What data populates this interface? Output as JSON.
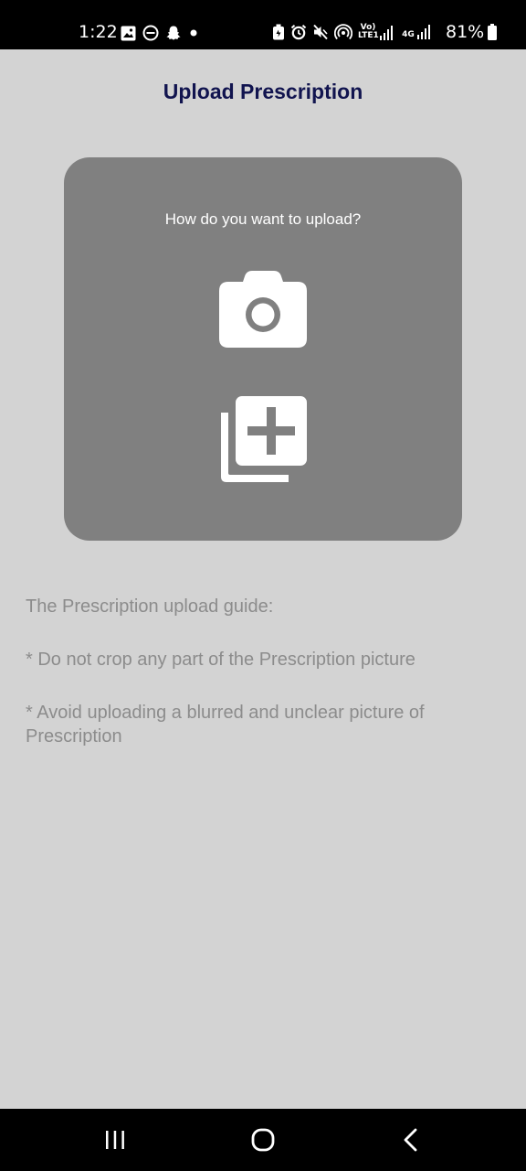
{
  "status_bar": {
    "time": "1:22",
    "left_icons": [
      "gallery-icon",
      "do-not-disturb-icon",
      "snapchat-icon",
      "dot-icon"
    ],
    "right_icons": [
      "battery-saver-icon",
      "alarm-icon",
      "mute-icon",
      "hotspot-icon",
      "volte-signal-icon",
      "4g-signal-icon"
    ],
    "volte_label": "Vo) LTE1",
    "net_label": "4G",
    "battery": "81%"
  },
  "header": {
    "title": "Upload Prescription"
  },
  "upload_card": {
    "question": "How do you want to upload?",
    "camera_icon": "camera-icon",
    "gallery_icon": "add-photo-library-icon"
  },
  "guide": {
    "title": "The Prescription upload guide:",
    "items": [
      "* Do not crop any part of the Prescription picture",
      "* Avoid uploading a blurred and unclear picture of Prescription"
    ]
  },
  "nav_bar": {
    "buttons": [
      "recent-apps-icon",
      "home-icon",
      "back-icon"
    ]
  },
  "colors": {
    "background": "#d3d3d3",
    "card": "#808080",
    "title": "#11144f",
    "guide_text": "#8c8c8c"
  }
}
